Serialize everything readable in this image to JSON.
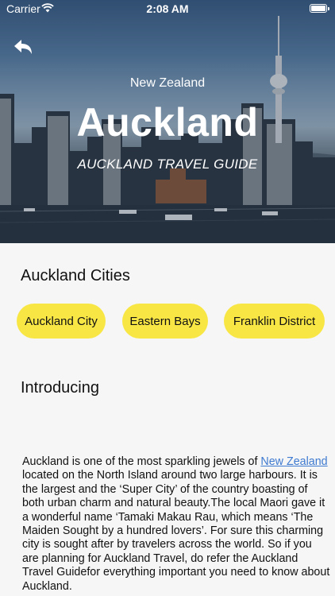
{
  "status_bar": {
    "carrier": "Carrier",
    "time": "2:08 AM"
  },
  "hero": {
    "country": "New Zealand",
    "title": "Auckland",
    "subtitle": "AUCKLAND TRAVEL GUIDE"
  },
  "cities_section": {
    "title": "Auckland Cities",
    "chips": [
      "Auckland City",
      "Eastern Bays",
      "Franklin District"
    ]
  },
  "intro_section": {
    "title": "Introducing",
    "text_before_link": "Auckland is one of the most sparkling jewels of ",
    "link_text": "New Zealand",
    "text_after_link": " located on the North Island around two large harbours. It is the largest and the ‘Super City’ of the country boasting of both urban charm and natural beauty.The local Maori gave it a wonderful name ‘Tamaki Makau Rau, which means ‘The Maiden Sought by a hundred lovers’. For sure this charming city is sought after by travelers across the world. So if you are planning for Auckland Travel, do refer the Auckland Travel Guidefor everything important you need to know about Auckland."
  },
  "colors": {
    "chip_background": "#f8e645",
    "link": "#3e7ad0",
    "page_background": "#f6f6f6"
  },
  "icons": [
    "wifi-icon",
    "battery-icon",
    "back-arrow-icon"
  ]
}
